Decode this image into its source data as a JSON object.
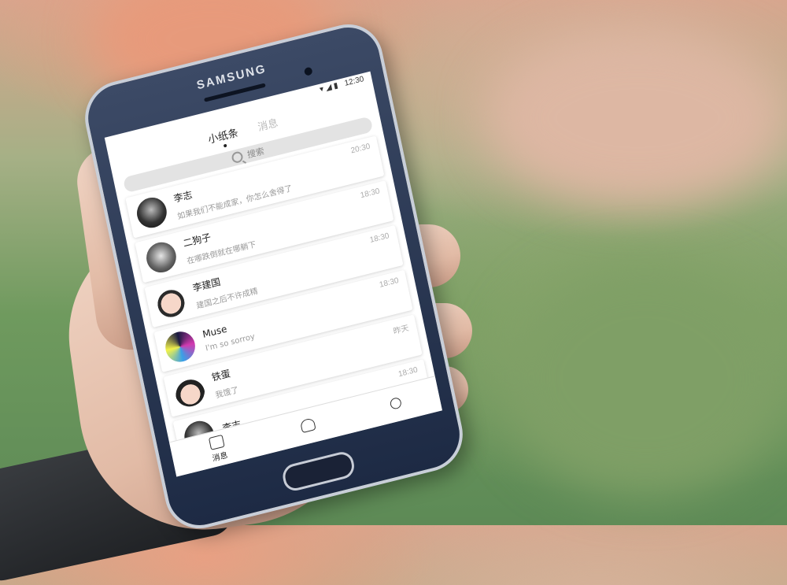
{
  "phone": {
    "brand": "SAMSUNG",
    "status": {
      "time": "12:30"
    }
  },
  "app": {
    "tabs": [
      {
        "label": "小纸条",
        "active": true
      },
      {
        "label": "消息",
        "active": false
      }
    ],
    "search": {
      "label": "搜索"
    },
    "chats": [
      {
        "name": "李志",
        "message": "如果我们不能成家，你怎么舍得了",
        "time": "20:30",
        "avatar": "avatar-li-zhi"
      },
      {
        "name": "二狗子",
        "message": "在哪跌倒就在哪躺下",
        "time": "18:30",
        "avatar": "avatar-er-gou-zi"
      },
      {
        "name": "李建国",
        "message": "建国之后不许成精",
        "time": "18:30",
        "avatar": "avatar-li-jian-guo"
      },
      {
        "name": "Muse",
        "message": "I'm so sorroy",
        "time": "18:30",
        "avatar": "avatar-muse"
      },
      {
        "name": "铁蛋",
        "message": "我饿了",
        "time": "昨天",
        "avatar": "avatar-tie-dan"
      },
      {
        "name": "李志",
        "message": "",
        "time": "18:30",
        "avatar": "avatar-li-zhi-2"
      }
    ],
    "bottom_nav": [
      {
        "label": "消息",
        "icon": "message-icon"
      },
      {
        "label": "",
        "icon": "friends-icon"
      },
      {
        "label": "",
        "icon": "profile-icon"
      }
    ]
  }
}
